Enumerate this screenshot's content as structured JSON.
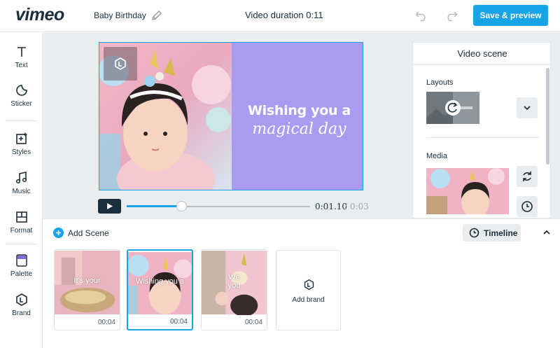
{
  "header": {
    "logo": "vimeo",
    "project_title": "Baby Birthday",
    "duration": "Video duration 0:11",
    "save_label": "Save & preview",
    "accent": "#17a3e8"
  },
  "toolbar": {
    "items": [
      {
        "label": "Text",
        "icon": "text-icon"
      },
      {
        "label": "Sticker",
        "icon": "sticker-icon"
      },
      {
        "label": "Styles",
        "icon": "styles-icon"
      },
      {
        "label": "Music",
        "icon": "music-icon"
      },
      {
        "label": "Format",
        "icon": "format-icon"
      },
      {
        "label": "Palette",
        "icon": "palette-icon"
      },
      {
        "label": "Brand",
        "icon": "brand-icon"
      }
    ]
  },
  "stage": {
    "headline": "Wishing you a",
    "subline": "magical day",
    "background": "#a89bf0"
  },
  "player": {
    "current_time": "0:01.10",
    "total_time": "/ 0:03",
    "progress": 0.3
  },
  "scene_panel": {
    "title": "Video scene",
    "layouts_label": "Layouts",
    "media_label": "Media"
  },
  "timeline": {
    "add_scene_label": "Add Scene",
    "timeline_label": "Timeline",
    "scenes": [
      {
        "caption": "It's your",
        "duration": "00:04"
      },
      {
        "caption": "Wishing you a",
        "duration": "00:04",
        "active": true
      },
      {
        "caption": "We\nyou",
        "duration": "00:04"
      }
    ],
    "add_brand_label": "Add brand"
  }
}
